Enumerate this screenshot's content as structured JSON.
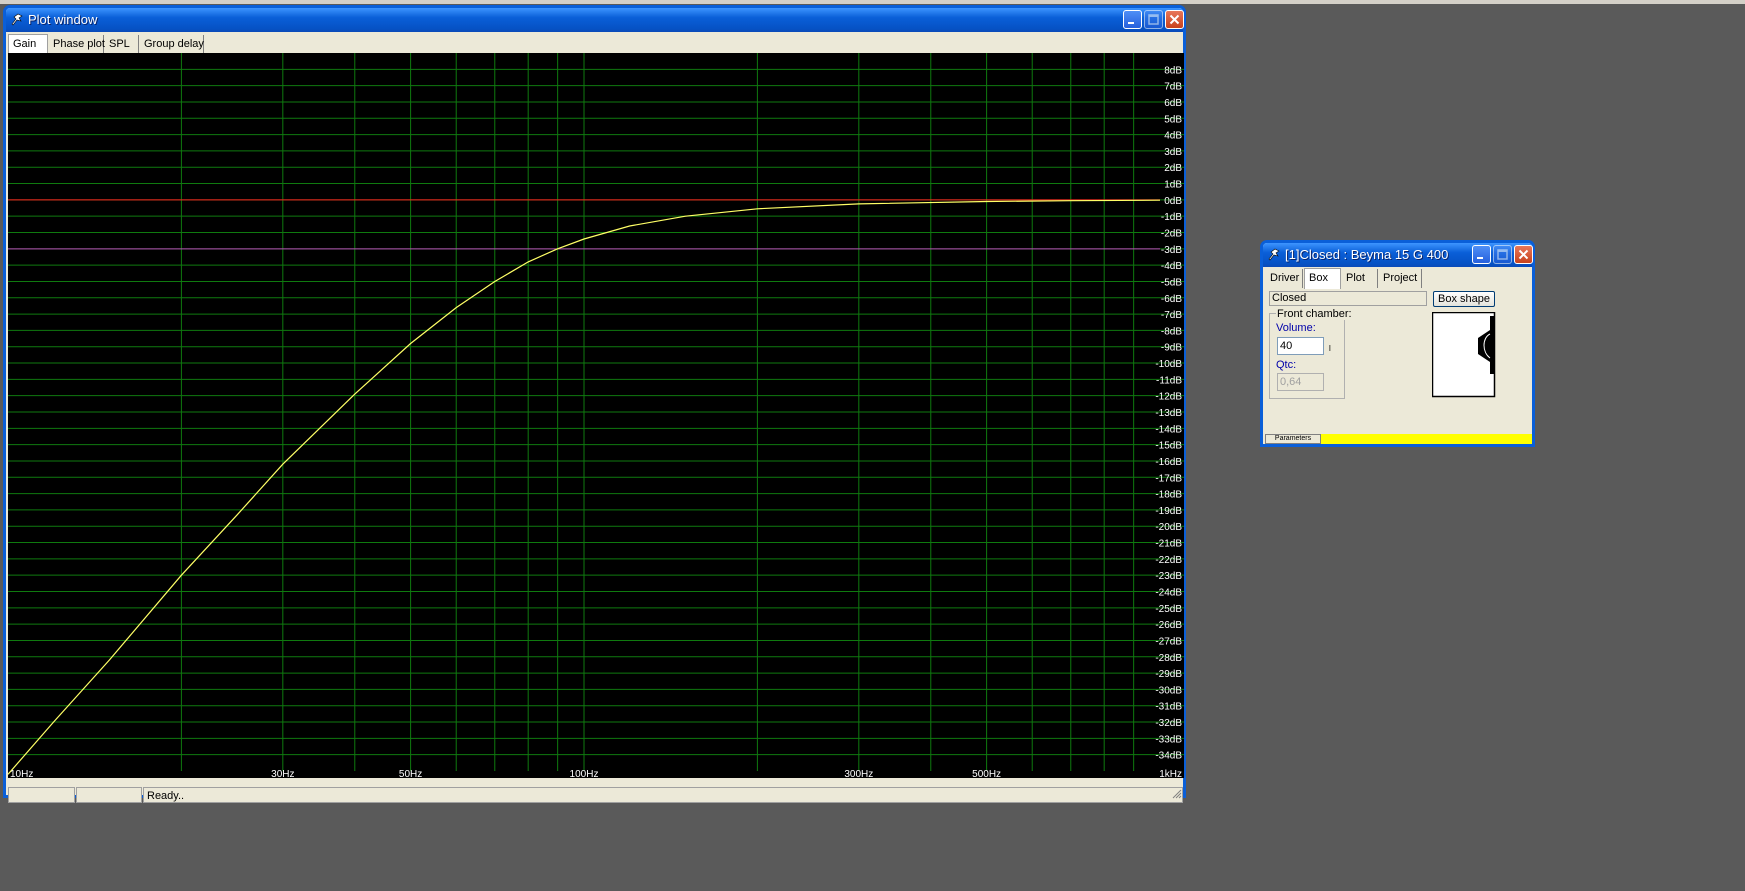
{
  "plot_window": {
    "title": "Plot window",
    "tabs": [
      {
        "label": "Gain",
        "active": true
      },
      {
        "label": "Phase plot",
        "active": false
      },
      {
        "label": "SPL",
        "active": false
      },
      {
        "label": "Group delay",
        "active": false
      }
    ],
    "status_text": "Ready..",
    "status_cells": [
      "",
      ""
    ]
  },
  "box_window": {
    "title": "[1]Closed : Beyma 15 G 400",
    "tabs": [
      {
        "label": "Driver",
        "active": false
      },
      {
        "label": "Box",
        "active": true
      },
      {
        "label": "Plot",
        "active": false
      },
      {
        "label": "Project",
        "active": false
      }
    ],
    "box_type_value": "Closed",
    "box_shape_button": "Box shape",
    "front_chamber_label": "Front chamber:",
    "volume_label": "Volume:",
    "volume_value": "40",
    "volume_unit": "l",
    "qtc_label": "Qtc:",
    "qtc_value": "0,64",
    "bottom_tab": "Parameters"
  },
  "colors": {
    "plot_bg": "#000000",
    "grid": "#0f7a0f",
    "curve": "#ffff66",
    "zero_line": "#ff2020",
    "minus3_line": "#ff40ff",
    "tick_label": "#ffffff",
    "status_bar_fill": "#ffff00"
  },
  "chart_data": {
    "type": "line",
    "x_scale": "log",
    "xlim": [
      10,
      1000
    ],
    "ylim": [
      -35,
      9
    ],
    "x_ticks": [
      {
        "value": 10,
        "label": "10Hz"
      },
      {
        "value": 30,
        "label": "30Hz"
      },
      {
        "value": 50,
        "label": "50Hz"
      },
      {
        "value": 100,
        "label": "100Hz"
      },
      {
        "value": 300,
        "label": "300Hz"
      },
      {
        "value": 500,
        "label": "500Hz"
      },
      {
        "value": 1000,
        "label": "1kHz"
      }
    ],
    "x_grid": [
      20,
      30,
      40,
      50,
      60,
      70,
      80,
      90,
      100,
      200,
      300,
      400,
      500,
      600,
      700,
      800,
      900
    ],
    "y_ticks": [
      8,
      7,
      6,
      5,
      4,
      3,
      2,
      1,
      0,
      -1,
      -2,
      -3,
      -4,
      -5,
      -6,
      -7,
      -8,
      -9,
      -10,
      -11,
      -12,
      -13,
      -14,
      -15,
      -16,
      -17,
      -18,
      -19,
      -20,
      -21,
      -22,
      -23,
      -24,
      -25,
      -26,
      -27,
      -28,
      -29,
      -30,
      -31,
      -32,
      -33,
      -34
    ],
    "y_tick_suffix": "dB",
    "reference_lines": [
      0,
      -3
    ],
    "series": [
      {
        "x": [
          10,
          12,
          15,
          20,
          25,
          30,
          40,
          50,
          60,
          70,
          80,
          90,
          100,
          120,
          150,
          200,
          300,
          500,
          700,
          1000
        ],
        "y": [
          -35.2,
          -32.0,
          -28.2,
          -23.0,
          -19.3,
          -16.2,
          -11.9,
          -8.8,
          -6.6,
          -5.0,
          -3.8,
          -3.0,
          -2.4,
          -1.6,
          -1.0,
          -0.55,
          -0.25,
          -0.1,
          -0.05,
          -0.02
        ]
      }
    ],
    "grid": true
  }
}
